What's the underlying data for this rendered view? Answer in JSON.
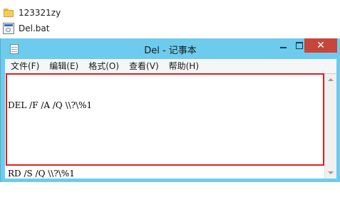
{
  "explorer": {
    "items": [
      {
        "icon": "folder-icon",
        "label": "123321zy"
      },
      {
        "icon": "bat-file-icon",
        "label": "Del.bat"
      }
    ]
  },
  "window": {
    "title": "Del - 记事本",
    "close_glyph": "✕"
  },
  "menu": {
    "items": [
      {
        "label": "文件(F)"
      },
      {
        "label": "编辑(E)"
      },
      {
        "label": "格式(O)"
      },
      {
        "label": "查看(V)"
      },
      {
        "label": "帮助(H)"
      }
    ]
  },
  "editor": {
    "lines": [
      "DEL /F /A /Q \\\\?\\%1",
      "",
      "RD /S /Q \\\\?\\%1"
    ]
  },
  "colors": {
    "titlebar": "#6dcbee",
    "close_button": "#c7463b",
    "highlight_box": "#e02020"
  }
}
